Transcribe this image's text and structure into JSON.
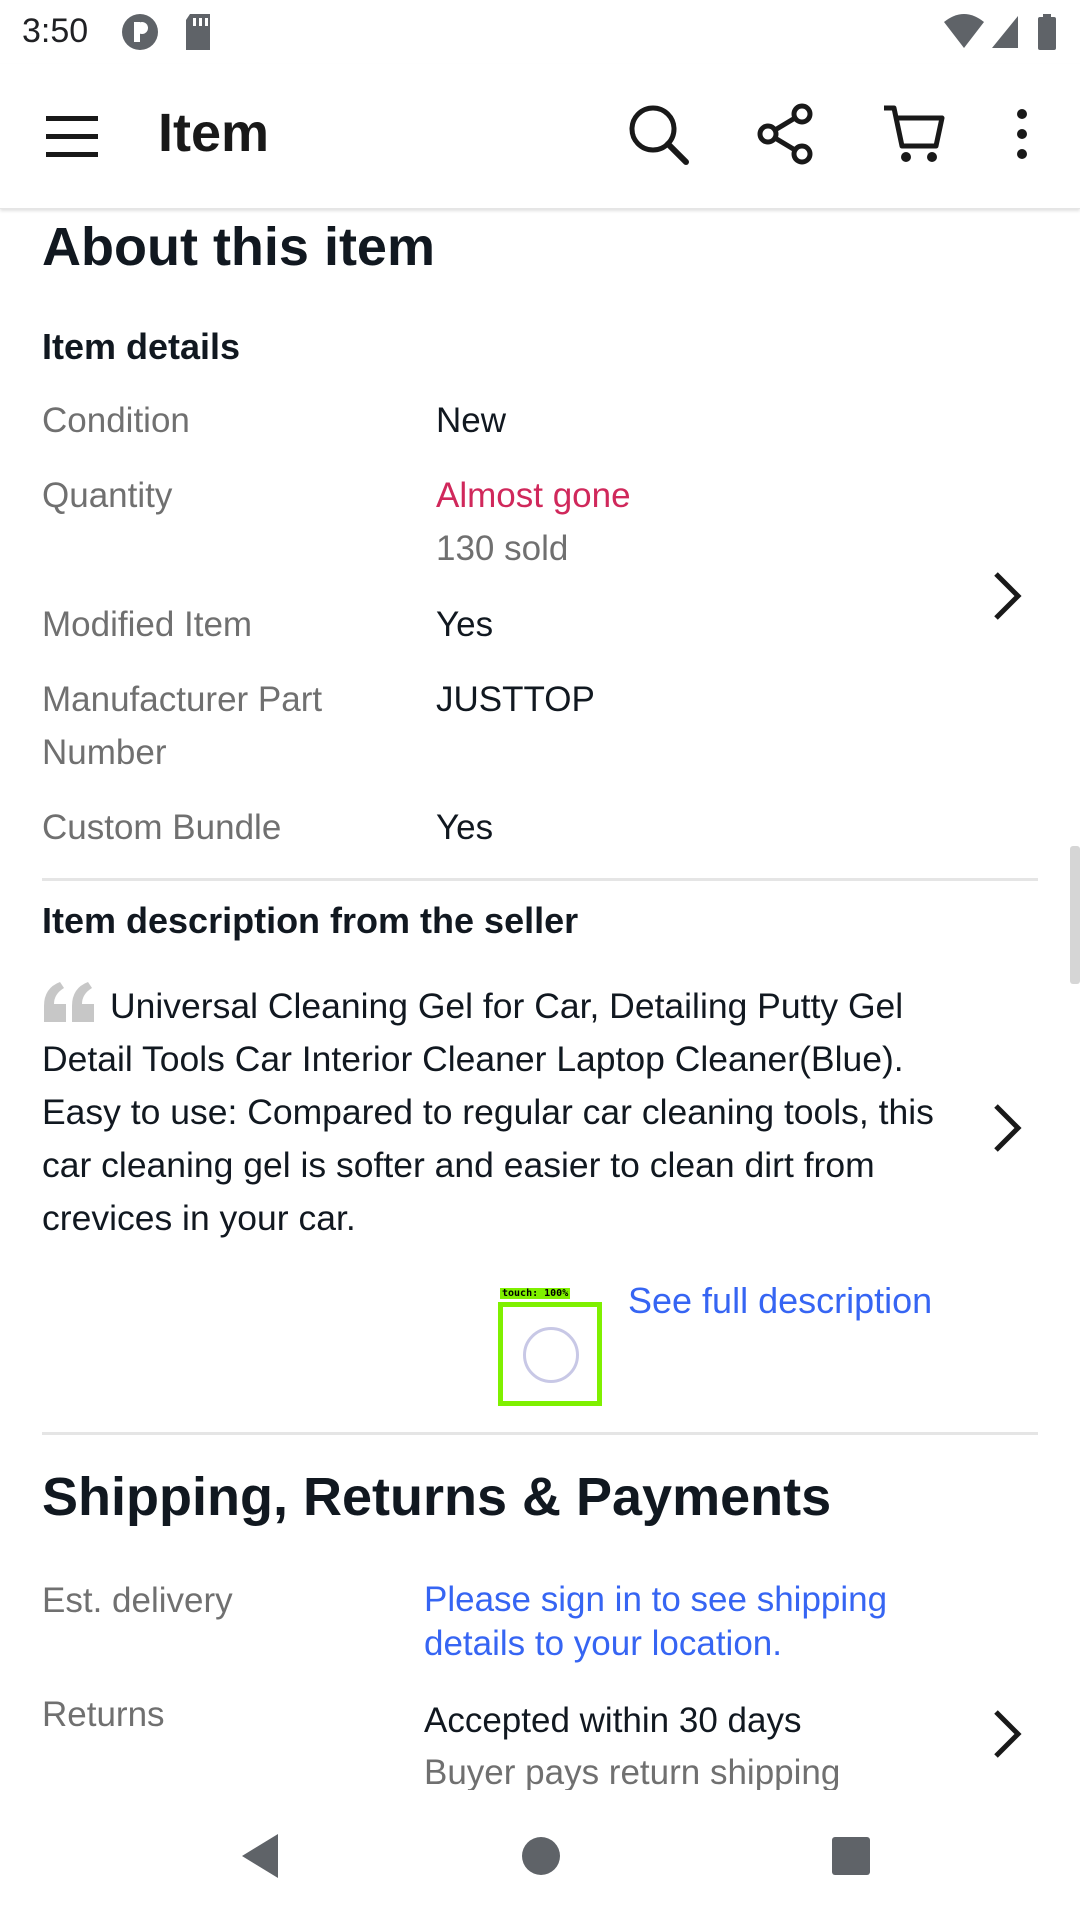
{
  "status_bar": {
    "time": "3:50"
  },
  "app_bar": {
    "title": "Item"
  },
  "about": {
    "heading": "About this item",
    "details_heading": "Item details",
    "rows": [
      {
        "label": "Condition",
        "value": "New"
      },
      {
        "label": "Quantity",
        "value": "Almost gone",
        "subvalue": "130 sold"
      },
      {
        "label": "Modified Item",
        "value": "Yes"
      },
      {
        "label": "Manufacturer Part Number",
        "value": "JUSTTOP"
      },
      {
        "label": "Custom Bundle",
        "value": "Yes"
      }
    ]
  },
  "description": {
    "heading": "Item description from the seller",
    "text": "Universal Cleaning Gel for Car, Detailing Putty Gel Detail Tools Car Interior Cleaner Laptop Cleaner(Blue). Easy to use: Compared to regular car cleaning tools, this car cleaning gel is softer and easier to clean dirt from crevices in your car.",
    "see_full": "See full description",
    "touch_label": "touch: 100%"
  },
  "shipping": {
    "heading": "Shipping, Returns & Payments",
    "delivery_label": "Est. delivery",
    "delivery_value": "Please sign in to see shipping details to your location.",
    "returns_label": "Returns",
    "returns_value": "Accepted within 30 days",
    "returns_sub": "Buyer pays return shipping"
  },
  "colors": {
    "accent_link": "#3665f3",
    "alert_red": "#d0285b",
    "touch_green": "#7ff000"
  },
  "icons": [
    "wifi-icon",
    "signal-icon",
    "battery-icon",
    "menu-icon",
    "search-icon",
    "share-icon",
    "cart-icon",
    "more-icon",
    "chevron-right-icon",
    "quote-icon",
    "back-icon",
    "home-icon",
    "recents-icon"
  ]
}
